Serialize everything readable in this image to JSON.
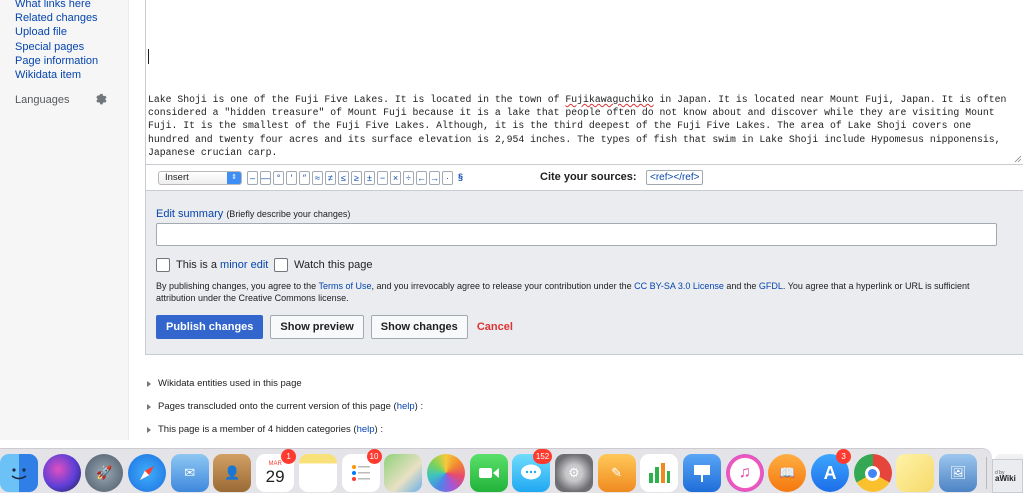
{
  "sidebar": {
    "tools": [
      "What links here",
      "Related changes",
      "Upload file",
      "Special pages",
      "Page information",
      "Wikidata item"
    ],
    "languages_heading": "Languages"
  },
  "editor": {
    "text_before": "Lake Shoji is one of the Fuji Five Lakes. It is located in the town of ",
    "misspelled_word": "Fujikawaguchiko",
    "text_after": " in Japan. It is located near Mount Fuji, Japan. It is often considered a \"hidden treasure\" of Mount Fuji because it is a lake that people often do not know about and discover while they are visiting Mount Fuji. It is the smallest of the Fuji Five Lakes. Although, it is the third deepest of the Fuji Five Lakes. The area of Lake Shoji covers one hundred and twenty four acres and its surface elevation is 2,954 inches. The types of fish that swim in Lake Shoji include Hypomesus nipponensis, Japanese crucian carp."
  },
  "toolbar": {
    "insert_select_value": "Insert",
    "chars": [
      "–",
      "—",
      "°",
      "′",
      "″",
      "≈",
      "≠",
      "≤",
      "≥",
      "±",
      "−",
      "×",
      "÷",
      "←",
      "→",
      "·"
    ],
    "section_char": "§",
    "cite_label": "Cite your sources:",
    "cite_ref": "<ref></ref>"
  },
  "options": {
    "summary_label": "Edit summary",
    "summary_hint": "(Briefly describe your changes)",
    "summary_value": "",
    "minor_prefix": "This is a ",
    "minor_link": "minor edit",
    "watch_label": "Watch this page",
    "license": {
      "part1": "By publishing changes, you agree to the ",
      "terms_link": "Terms of Use",
      "part2": ", and you irrevocably agree to release your contribution under the ",
      "ccbysa_link": "CC BY-SA 3.0 License",
      "part3": " and the ",
      "gfdl_link": "GFDL",
      "part4": ". You agree that a hyperlink or URL is sufficient attribution under the Creative Commons license."
    },
    "buttons": {
      "publish": "Publish changes",
      "preview": "Show preview",
      "changes": "Show changes",
      "cancel": "Cancel"
    }
  },
  "info_list": [
    {
      "text": "Wikidata entities used in this page",
      "help": "",
      "suffix": ""
    },
    {
      "text": "Pages transcluded onto the current version of this page (",
      "help": "help",
      "suffix": ") :"
    },
    {
      "text": "This page is a member of 4 hidden categories (",
      "help": "help",
      "suffix": ") :"
    }
  ],
  "dock": {
    "calendar_month": "MAR",
    "calendar_day": "29",
    "badges": {
      "calendar": "1",
      "reminders": "10",
      "messages": "152",
      "app_store": "3"
    },
    "colors": {
      "finder": "#3c8ff1",
      "siri": "#5b3fd6",
      "launchpad": "#6b7b8c",
      "safari": "#1e8ef5",
      "mail": "#4f9de8",
      "notes_book": "#b88547",
      "calendar": "#ffffff",
      "notes": "#f9e17a",
      "reminders": "#ffffff",
      "maps": "#7fc66a",
      "photos": "#f2a33b",
      "facetime": "#3cc84b",
      "messages": "#30c3f5",
      "sysprefs": "#8b8b8f",
      "pages": "#f3a530",
      "numbers": "#2db14d",
      "keynote": "#2f7fe0",
      "itunes": "#f556b8",
      "books": "#f48a1f",
      "app_store": "#2d8ff2",
      "chrome": "#e5453a",
      "stickies": "#f6e27a",
      "preview": "#6c9cd2"
    },
    "powered_by_line1": "d by",
    "powered_by_line2": "aWiki"
  }
}
